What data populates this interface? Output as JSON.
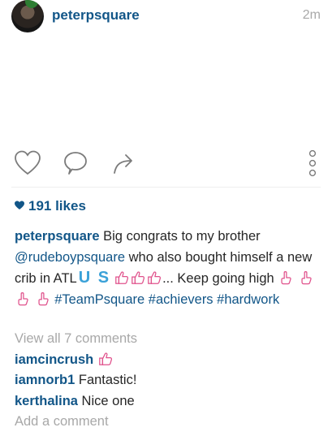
{
  "post": {
    "username": "peterpsquare",
    "time_ago": "2m"
  },
  "likes": {
    "text": "191 likes"
  },
  "caption": {
    "username": "peterpsquare",
    "text_1": "Big congrats to my brother",
    "mention": "@rudeboypsquare",
    "text_2": "who also bought himself a new crib in ATL",
    "flag_text": "U S",
    "text_3": "... Keep going high",
    "hashtag_1": "#TeamPsquare",
    "hashtag_2": "#achievers",
    "hashtag_3": "#hardwork"
  },
  "comments": {
    "view_all": "View all 7 comments",
    "items": [
      {
        "username": "iamcincrush",
        "text": ""
      },
      {
        "username": "iamnorb1",
        "text": "Fantastic!"
      },
      {
        "username": "kerthalina",
        "text": "Nice one"
      }
    ],
    "add_placeholder": "Add a comment"
  },
  "icons": {
    "like": "heart-icon",
    "comment": "comment-icon",
    "share": "share-arrow-icon",
    "more": "vertical-dots-icon",
    "likes_heart": "small-heart-icon",
    "thumbs_up": "thumbs-up-emoji",
    "pointing_up": "pointing-up-emoji"
  },
  "colors": {
    "link_blue": "#125688",
    "muted_gray": "#a8a8a8",
    "emoji_pink": "#e0528c",
    "flag_blue": "#3aa1d8"
  }
}
